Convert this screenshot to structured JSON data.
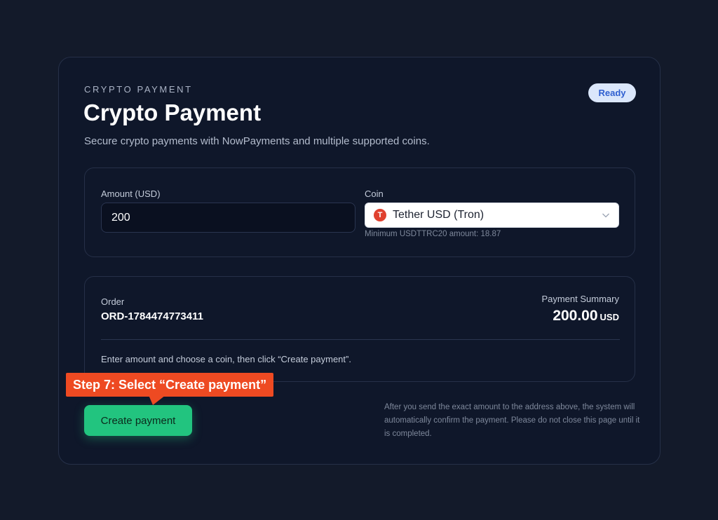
{
  "header": {
    "eyebrow": "CRYPTO PAYMENT",
    "title": "Crypto Payment",
    "subtitle": "Secure crypto payments with NowPayments and multiple supported coins.",
    "status_badge": "Ready"
  },
  "form": {
    "amount_label": "Amount (USD)",
    "amount_value": "200",
    "coin_label": "Coin",
    "coin_selected": "Tether USD (Tron)",
    "coin_icon_glyph": "T",
    "coin_icon_color": "#e0412f",
    "coin_hint": "Minimum USDTTRC20 amount: 18.87"
  },
  "summary": {
    "order_label": "Order",
    "order_id": "ORD-1784474773411",
    "summary_label": "Payment Summary",
    "amount": "200.00",
    "currency": "USD",
    "instruction": "Enter amount and choose a coin, then click “Create payment”."
  },
  "actions": {
    "create_label": "Create payment",
    "accent_color": "#22c47f"
  },
  "note": "After you send the exact amount to the address above, the system will automatically confirm the payment. Please do not close this page until it is completed.",
  "callout": {
    "text": "Step 7: Select “Create payment”",
    "color": "#ee4a22"
  }
}
